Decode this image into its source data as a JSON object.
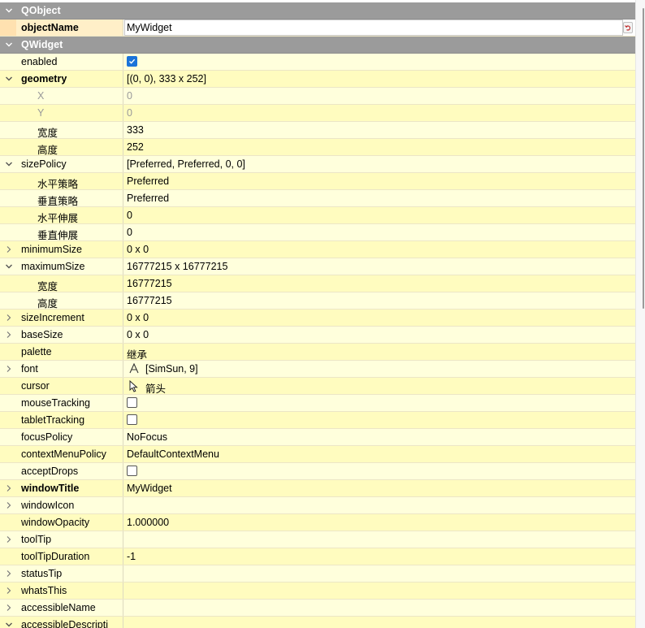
{
  "groups": {
    "qobject": "QObject",
    "qwidget": "QWidget"
  },
  "object_name": {
    "label": "objectName",
    "value": "MyWidget"
  },
  "properties": [
    {
      "id": "enabled",
      "label": "enabled",
      "checkbox": true,
      "checked": true
    },
    {
      "id": "geometry",
      "label": "geometry",
      "value": "[(0, 0), 333 x 252]",
      "expanded": true,
      "bold": true
    },
    {
      "id": "geometry-x",
      "label": "X",
      "value": "0",
      "child": true,
      "disabled": true
    },
    {
      "id": "geometry-y",
      "label": "Y",
      "value": "0",
      "child": true,
      "disabled": true
    },
    {
      "id": "geometry-width",
      "label": "宽度",
      "value": "333",
      "child": true
    },
    {
      "id": "geometry-height",
      "label": "高度",
      "value": "252",
      "child": true
    },
    {
      "id": "sizepolicy",
      "label": "sizePolicy",
      "value": "[Preferred, Preferred, 0, 0]",
      "expanded": true
    },
    {
      "id": "sizepolicy-hpolicy",
      "label": "水平策略",
      "value": "Preferred",
      "child": true
    },
    {
      "id": "sizepolicy-vpolicy",
      "label": "垂直策略",
      "value": "Preferred",
      "child": true
    },
    {
      "id": "sizepolicy-hstretch",
      "label": "水平伸展",
      "value": "0",
      "child": true
    },
    {
      "id": "sizepolicy-vstretch",
      "label": "垂直伸展",
      "value": "0",
      "child": true
    },
    {
      "id": "minimumsize",
      "label": "minimumSize",
      "value": "0 x 0",
      "collapsed": true
    },
    {
      "id": "maximumsize",
      "label": "maximumSize",
      "value": "16777215 x 16777215",
      "expanded": true
    },
    {
      "id": "maximumsize-width",
      "label": "宽度",
      "value": "16777215",
      "child": true
    },
    {
      "id": "maximumsize-height",
      "label": "高度",
      "value": "16777215",
      "child": true
    },
    {
      "id": "sizeincrement",
      "label": "sizeIncrement",
      "value": "0 x 0",
      "collapsed": true
    },
    {
      "id": "basesize",
      "label": "baseSize",
      "value": "0 x 0",
      "collapsed": true
    },
    {
      "id": "palette",
      "label": "palette",
      "value": "继承"
    },
    {
      "id": "font",
      "label": "font",
      "value": "[SimSun, 9]",
      "collapsed": true,
      "icon": "font-icon"
    },
    {
      "id": "cursor",
      "label": "cursor",
      "value": "箭头",
      "icon": "cursor-arrow-icon"
    },
    {
      "id": "mousetracking",
      "label": "mouseTracking",
      "checkbox": true,
      "checked": false
    },
    {
      "id": "tablettracking",
      "label": "tabletTracking",
      "checkbox": true,
      "checked": false
    },
    {
      "id": "focuspolicy",
      "label": "focusPolicy",
      "value": "NoFocus"
    },
    {
      "id": "contextmenupolicy",
      "label": "contextMenuPolicy",
      "value": "DefaultContextMenu"
    },
    {
      "id": "acceptdrops",
      "label": "acceptDrops",
      "checkbox": true,
      "checked": false
    },
    {
      "id": "windowtitle",
      "label": "windowTitle",
      "value": "MyWidget",
      "collapsed": true,
      "bold": true
    },
    {
      "id": "windowicon",
      "label": "windowIcon",
      "value": "",
      "collapsed": true
    },
    {
      "id": "windowopacity",
      "label": "windowOpacity",
      "value": "1.000000"
    },
    {
      "id": "tooltip",
      "label": "toolTip",
      "value": "",
      "collapsed": true
    },
    {
      "id": "tooltipduration",
      "label": "toolTipDuration",
      "value": "-1"
    },
    {
      "id": "statustip",
      "label": "statusTip",
      "value": "",
      "collapsed": true
    },
    {
      "id": "whatsthis",
      "label": "whatsThis",
      "value": "",
      "collapsed": true
    },
    {
      "id": "accessiblename",
      "label": "accessibleName",
      "value": "",
      "collapsed": true
    },
    {
      "id": "accessibledescription",
      "label": "accessibleDescripti",
      "value": "",
      "expanded": true
    }
  ]
}
